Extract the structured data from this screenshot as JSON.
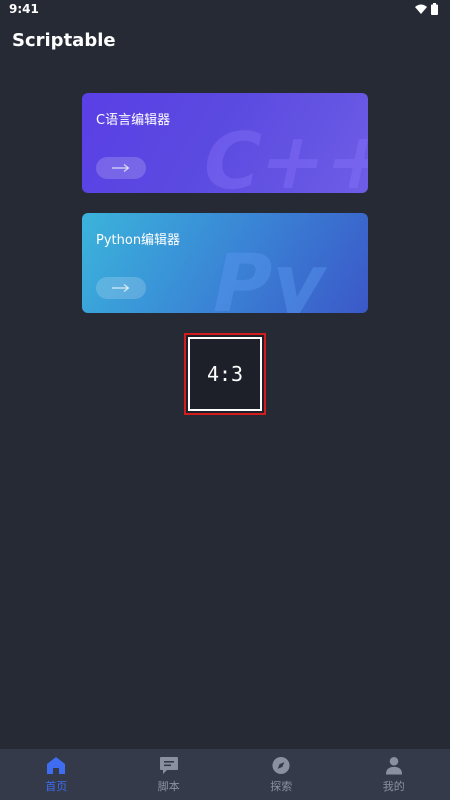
{
  "status_bar": {
    "time": "9:41"
  },
  "app": {
    "title": "Scriptable"
  },
  "cards": [
    {
      "label": "C语言编辑器",
      "arrow": "→",
      "deco_text": "C++"
    },
    {
      "label": "Python编辑器",
      "arrow": "→",
      "deco_text": "Py"
    }
  ],
  "ratio_badge": {
    "text": "4:3"
  },
  "tabbar": {
    "tabs": [
      {
        "label": "首页",
        "icon": "home-icon",
        "active": true
      },
      {
        "label": "脚本",
        "icon": "message-icon",
        "active": false
      },
      {
        "label": "探索",
        "icon": "compass-icon",
        "active": false
      },
      {
        "label": "我的",
        "icon": "user-icon",
        "active": false
      }
    ]
  },
  "colors": {
    "background": "#262a35",
    "tabbar": "#343a4a",
    "active": "#3f6df1",
    "inactive": "#8a909f",
    "badge_border": "#d31c1c"
  }
}
